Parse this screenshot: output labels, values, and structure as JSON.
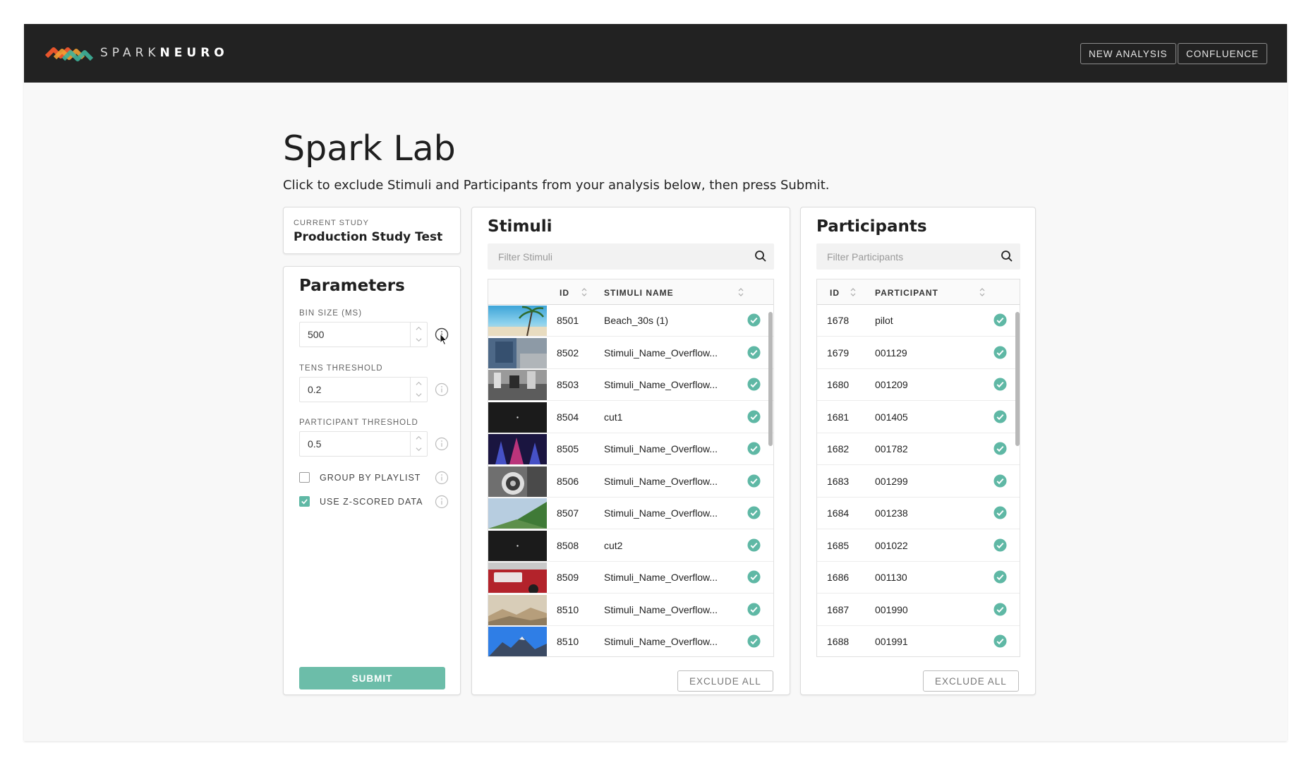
{
  "app": {
    "brand_light": "SPARK",
    "brand_bold": "NEURO",
    "nav": {
      "new_analysis": "NEW ANALYSIS",
      "confluence": "CONFLUENCE"
    }
  },
  "page": {
    "title": "Spark Lab",
    "subtitle": "Click to exclude Stimuli and Participants from your analysis below, then press Submit."
  },
  "study": {
    "label": "CURRENT STUDY",
    "name": "Production Study Test"
  },
  "parameters": {
    "title": "Parameters",
    "bin_size": {
      "label": "BIN SIZE (MS)",
      "value": "500"
    },
    "tens_threshold": {
      "label": "TENS THRESHOLD",
      "value": "0.2"
    },
    "participant_threshold": {
      "label": "PARTICIPANT THRESHOLD",
      "value": "0.5"
    },
    "group_by_playlist": {
      "label": "GROUP BY PLAYLIST",
      "checked": false
    },
    "use_z_scored": {
      "label": "USE Z-SCORED DATA",
      "checked": true
    },
    "submit_label": "SUBMIT"
  },
  "stimuli": {
    "title": "Stimuli",
    "filter_placeholder": "Filter Stimuli",
    "col_id": "ID",
    "col_name": "STIMULI NAME",
    "exclude_label": "EXCLUDE ALL",
    "rows": [
      {
        "id": "8501",
        "name": "Beach_30s (1)",
        "thumb": "beach-thumbnail"
      },
      {
        "id": "8502",
        "name": "Stimuli_Name_Overflow...",
        "thumb": "jeans-thumbnail"
      },
      {
        "id": "8503",
        "name": "Stimuli_Name_Overflow...",
        "thumb": "bw-city-thumbnail"
      },
      {
        "id": "8504",
        "name": "cut1",
        "thumb": "black-frame-thumbnail"
      },
      {
        "id": "8505",
        "name": "Stimuli_Name_Overflow...",
        "thumb": "neon-stage-thumbnail"
      },
      {
        "id": "8506",
        "name": "Stimuli_Name_Overflow...",
        "thumb": "bw-wheel-thumbnail"
      },
      {
        "id": "8507",
        "name": "Stimuli_Name_Overflow...",
        "thumb": "hillside-thumbnail"
      },
      {
        "id": "8508",
        "name": "cut2",
        "thumb": "black-frame-thumbnail"
      },
      {
        "id": "8509",
        "name": "Stimuli_Name_Overflow...",
        "thumb": "red-car-thumbnail"
      },
      {
        "id": "8510",
        "name": "Stimuli_Name_Overflow...",
        "thumb": "foggy-landscape-thumbnail"
      },
      {
        "id": "8510",
        "name": "Stimuli_Name_Overflow...",
        "thumb": "mountain-sky-thumbnail"
      }
    ]
  },
  "participants": {
    "title": "Participants",
    "filter_placeholder": "Filter Participants",
    "col_id": "ID",
    "col_name": "PARTICIPANT",
    "exclude_label": "EXCLUDE ALL",
    "rows": [
      {
        "id": "1678",
        "name": "pilot"
      },
      {
        "id": "1679",
        "name": "001129"
      },
      {
        "id": "1680",
        "name": "001209"
      },
      {
        "id": "1681",
        "name": "001405"
      },
      {
        "id": "1682",
        "name": "001782"
      },
      {
        "id": "1683",
        "name": "001299"
      },
      {
        "id": "1684",
        "name": "001238"
      },
      {
        "id": "1685",
        "name": "001022"
      },
      {
        "id": "1686",
        "name": "001130"
      },
      {
        "id": "1687",
        "name": "001990"
      },
      {
        "id": "1688",
        "name": "001991"
      }
    ]
  },
  "colors": {
    "accent": "#5fb8a5",
    "topbar": "#222222",
    "check": "#5fb8a5"
  }
}
